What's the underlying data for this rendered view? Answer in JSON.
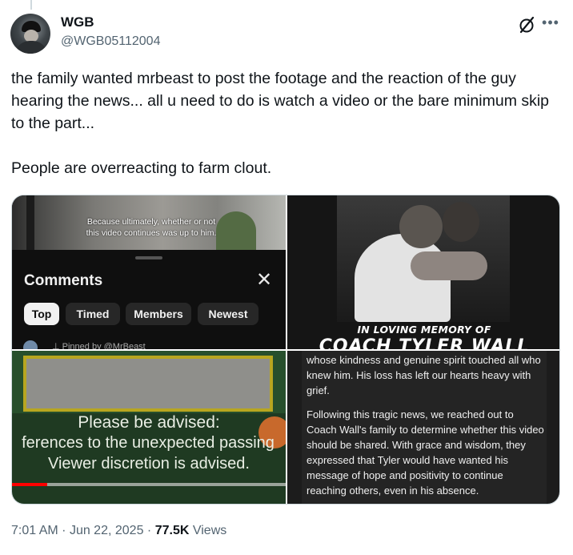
{
  "author": {
    "name": "WGB",
    "handle": "@WGB05112004"
  },
  "tweet": {
    "text": "the family wanted mrbeast to post the footage and the reaction of the guy hearing the news... all u need to do is watch a video or the bare minimum skip to the part...\n\nPeople are overreacting to farm clout."
  },
  "media": {
    "comments_panel": {
      "caption": "Because ultimately, whether or not this video continues was up to him.",
      "title": "Comments",
      "chips": [
        "Top",
        "Timed",
        "Members",
        "Newest"
      ],
      "pinned": "Pinned by @MrBeast"
    },
    "memorial": {
      "line1": "IN LOVING MEMORY OF",
      "line2": "COACH TYLER WALL"
    },
    "advisory": {
      "line1": "Please be advised:",
      "line2": "ferences to the unexpected passing",
      "line3": "Viewer discretion is advised.",
      "progress": 0.13
    },
    "statement": {
      "para1": "whose kindness and genuine spirit touched all who knew him. His loss has left our hearts heavy with grief.",
      "para2": "Following this tragic news, we reached out to Coach Wall's family to determine whether this video should be shared. With grace and wisdom, they expressed that Tyler would have wanted his message of hope and positivity to continue reaching others, even in his absence."
    }
  },
  "meta": {
    "time": "7:01 AM",
    "date": "Jun 22, 2025",
    "views_count": "77.5K",
    "views_label": "Views",
    "sep": "·"
  },
  "colors": {
    "text": "#0f1419",
    "secondary": "#536471",
    "progress": "#ff0000"
  },
  "icons": [
    "grok-icon",
    "more-icon",
    "close-icon",
    "pin-icon"
  ]
}
